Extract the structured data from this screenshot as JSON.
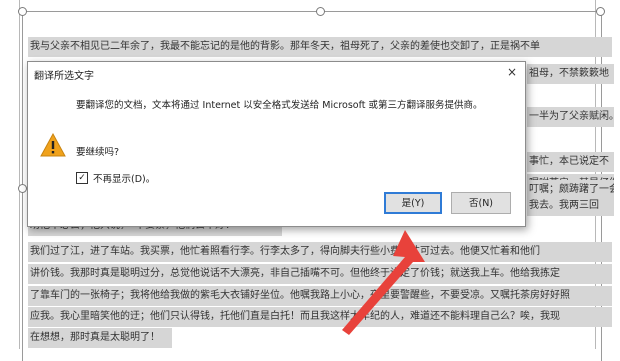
{
  "document": {
    "lines": [
      "我与父亲不相见已二年余了，我最不能忘记的是他的背影。那年冬天，祖母死了，父亲的差使也交卸了，正是祸不单",
      "                                                                                         祖母，不禁簌簌地",
      "                                                                                         一半为了父亲赋闲。",
      "                                                                                         事忙，本已说定不",
      "                                                                                         嘱咐茶房，甚是仔细",
      "                                                                                         叮嘱；颇踌躇了一会",
      "                                                                                         我去。我两三回",
      "劝他不必去；他只说，“不要紧，他们去不好！”",
      "我们过了江，进了车站。我买票，他忙着照看行李。行李太多了，得向脚夫行些小费，才可过去。他便又忙着和他们",
      "讲价钱。我那时真是聪明过分，总觉他说话不大漂亮，非自己插嘴不可。但他终于讲定了价钱；就送我上车。他给我拣定",
      "了靠车门的一张椅子；我将他给我做的紫毛大衣铺好坐位。他嘱我路上小心，夜里要警醒些，不要受凉。又嘱托茶房好好照",
      "应我。我心里暗笑他的迂；他们只认得钱，托他们直是白托！而且我这样大年纪的人，难道还不能料理自己么？唉，我现",
      "在想想，那时真是太聪明了！"
    ]
  },
  "dialog": {
    "title": "翻译所选文字",
    "close_label": "×",
    "message": "要翻译您的文档，文本将通过 Internet 以安全格式发送给 Microsoft 或第三方翻译服务提供商。",
    "question": "要继续吗?",
    "checkbox_checked": "✓",
    "checkbox_label": "不再显示(D)。",
    "yes_button": "是(Y)",
    "no_button": "否(N)",
    "warning_icon": "warning-icon"
  },
  "colors": {
    "selection": "#d6d6d6",
    "arrow": "#e8423b",
    "default_button_border": "#2f7bd6",
    "warning": "#f0a21c"
  }
}
